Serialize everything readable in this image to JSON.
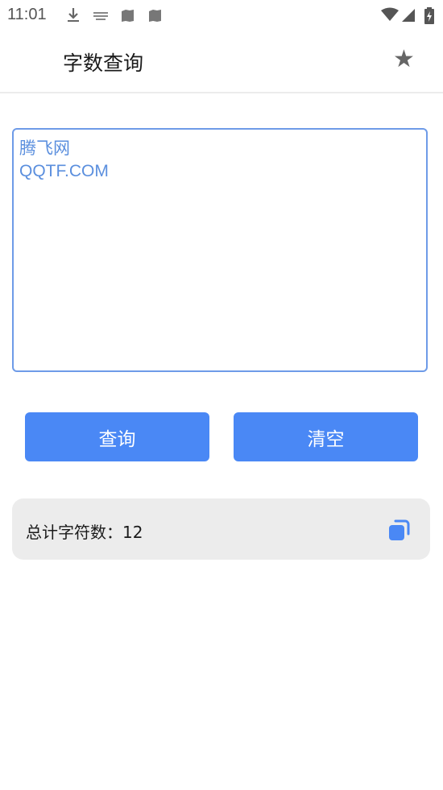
{
  "status_bar": {
    "time": "11:01",
    "left_icons": [
      "download-icon",
      "keyboard-icon",
      "book-icon",
      "book-icon"
    ],
    "right_icons": [
      "wifi-icon",
      "signal-icon",
      "battery-charging-icon"
    ]
  },
  "app_bar": {
    "title": "字数查询",
    "favorite_icon": "star-icon"
  },
  "input": {
    "value": "腾飞网\nQQTF.COM"
  },
  "buttons": {
    "query_label": "查询",
    "clear_label": "清空"
  },
  "result": {
    "label": "总计字符数：",
    "count": "12",
    "copy_icon": "copy-icon"
  },
  "colors": {
    "accent": "#4a88f5",
    "input_text": "#5b8fde",
    "result_bg": "#ececec"
  }
}
